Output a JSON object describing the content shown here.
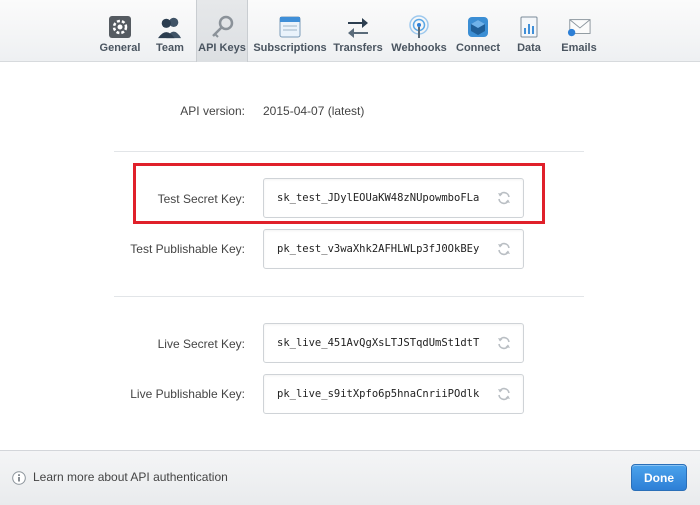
{
  "tabs": [
    {
      "label": "General",
      "icon": "gear-icon"
    },
    {
      "label": "Team",
      "icon": "team-icon"
    },
    {
      "label": "API Keys",
      "icon": "key-icon",
      "active": true
    },
    {
      "label": "Subscriptions",
      "icon": "subscriptions-icon"
    },
    {
      "label": "Transfers",
      "icon": "transfers-icon"
    },
    {
      "label": "Webhooks",
      "icon": "webhooks-icon"
    },
    {
      "label": "Connect",
      "icon": "connect-icon"
    },
    {
      "label": "Data",
      "icon": "data-icon"
    },
    {
      "label": "Emails",
      "icon": "emails-icon"
    }
  ],
  "api_version": {
    "label": "API version:",
    "value": "2015-04-07 (latest)"
  },
  "test_keys": {
    "secret_label": "Test Secret Key:",
    "secret_value": "sk_test_JDylEOUaKW48zNUpowmboFLa",
    "publishable_label": "Test Publishable Key:",
    "publishable_value": "pk_test_v3waXhk2AFHLWLp3fJ0OkBEy"
  },
  "live_keys": {
    "secret_label": "Live Secret Key:",
    "secret_value": "sk_live_451AvQgXsLTJSTqdUmSt1dtT",
    "publishable_label": "Live Publishable Key:",
    "publishable_value": "pk_live_s9itXpfo6p5hnaCnriiPOdlk"
  },
  "footer": {
    "learn_more": "Learn more about API authentication",
    "done_label": "Done"
  },
  "colors": {
    "highlight": "#e0202a",
    "done_button": "#2d7fd6"
  }
}
